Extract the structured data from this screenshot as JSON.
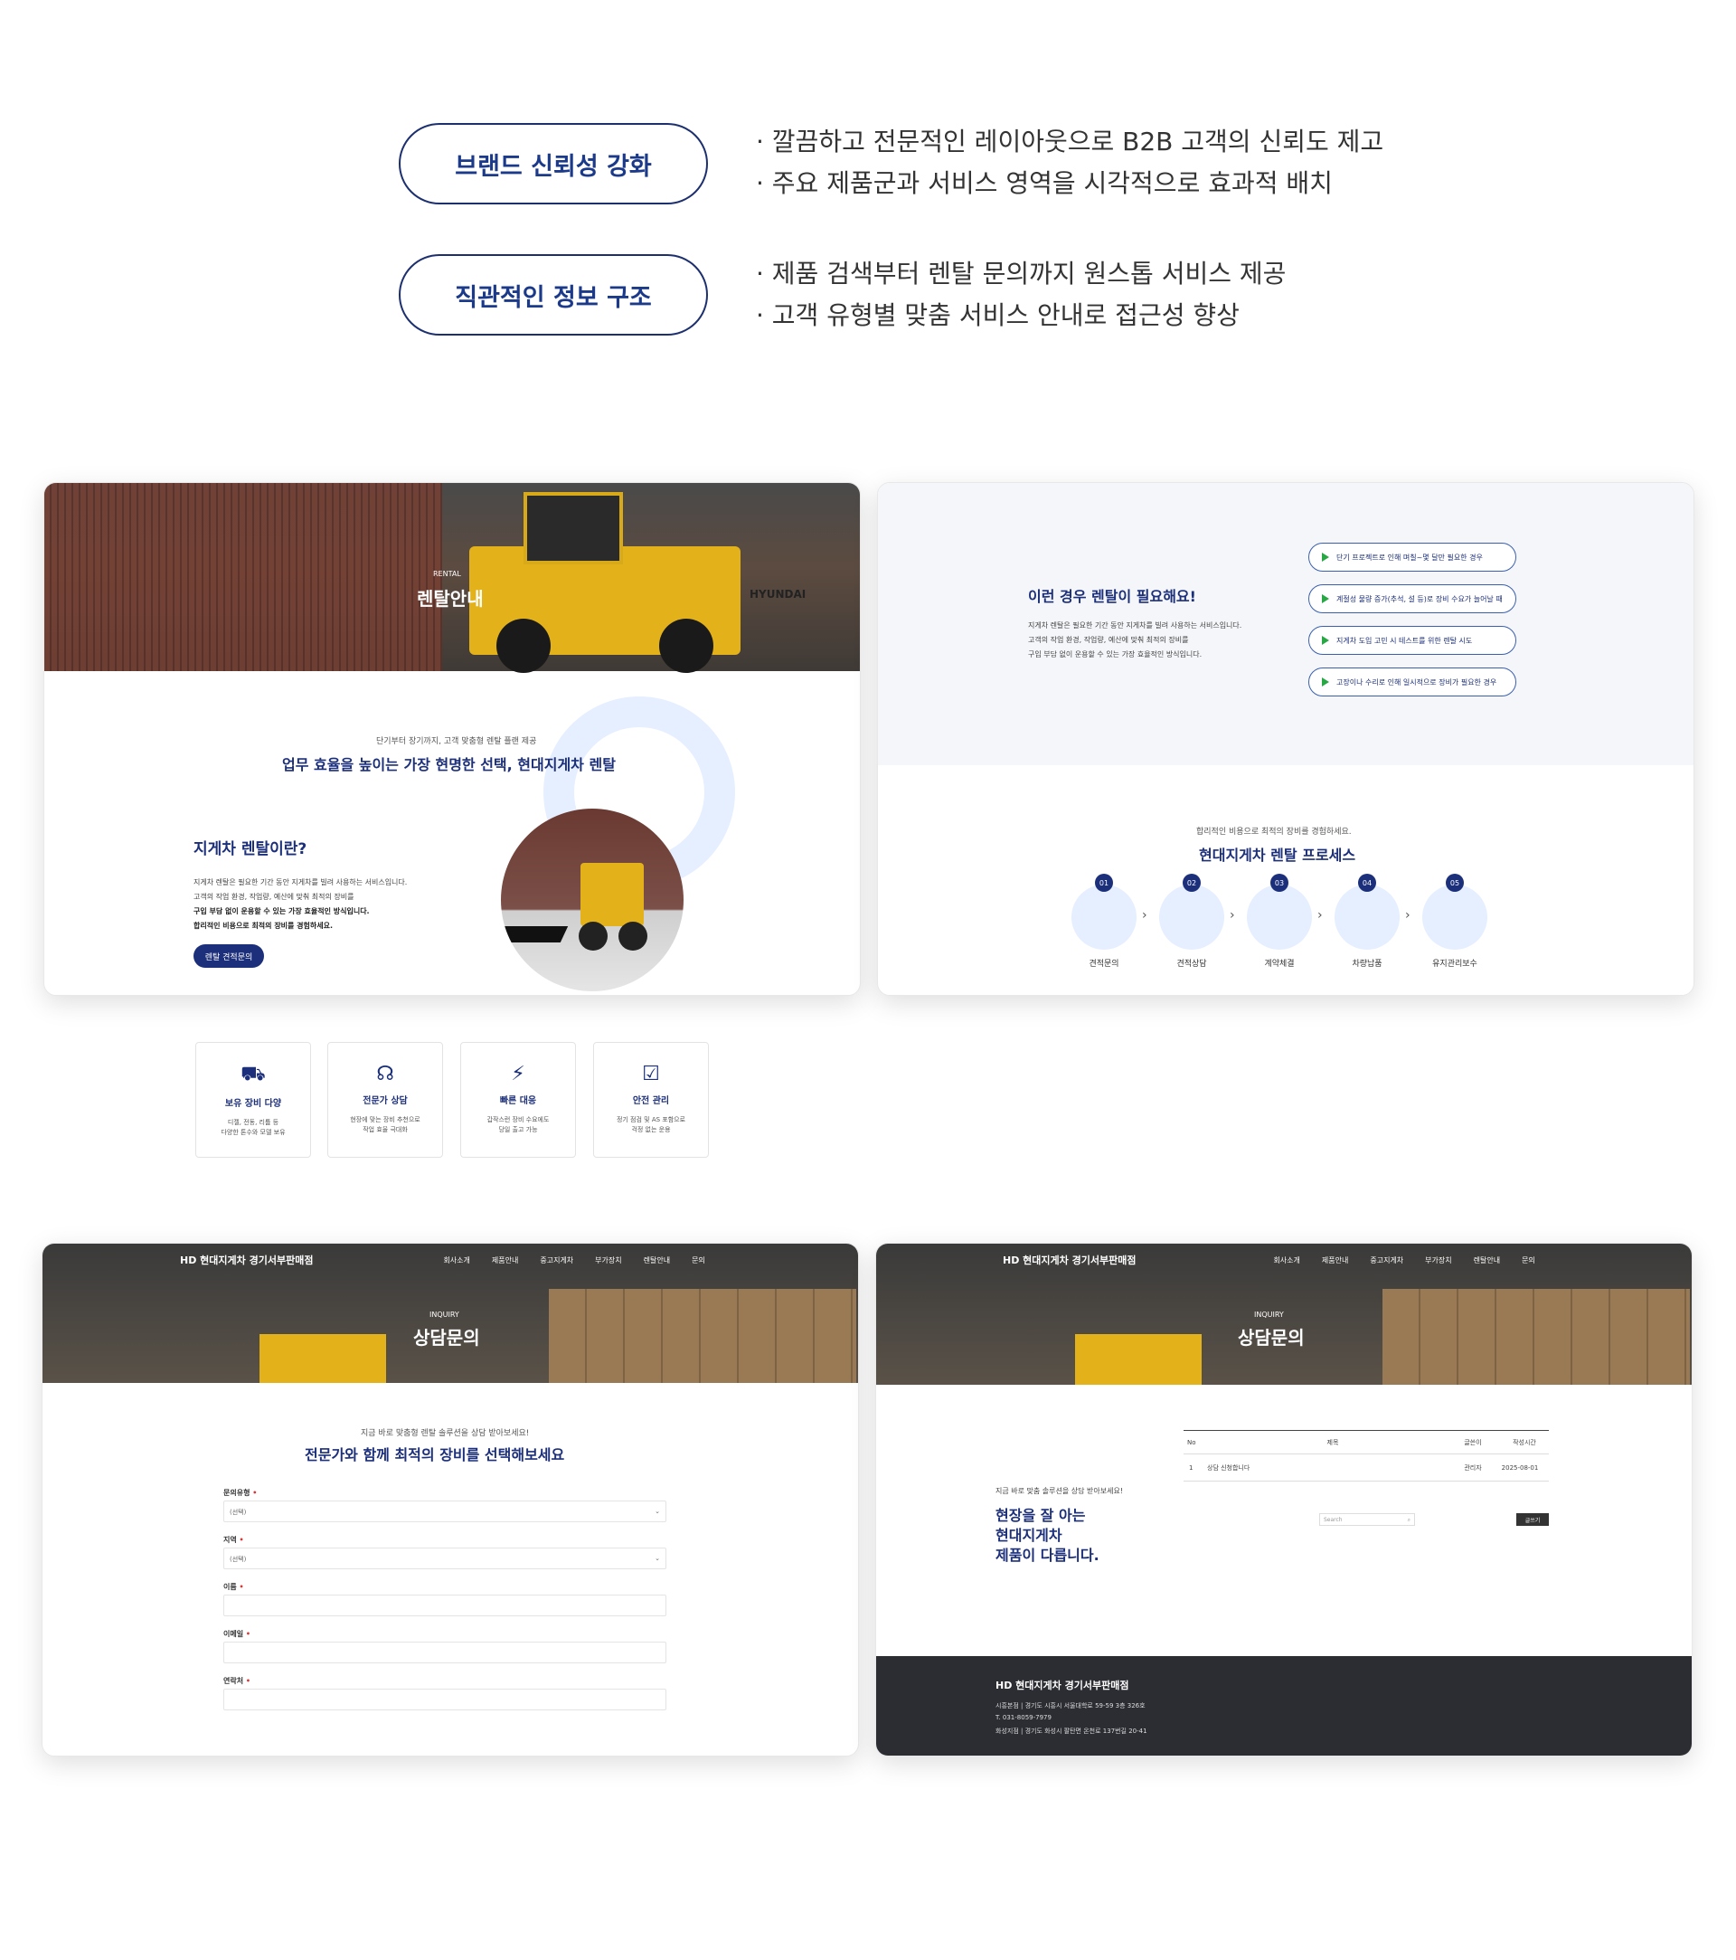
{
  "intro": {
    "items": [
      {
        "pill": "브랜드 신뢰성 강화",
        "bullets": [
          "· 깔끔하고 전문적인 레이아웃으로 B2B 고객의 신뢰도 제고",
          "· 주요 제품군과 서비스 영역을 시각적으로 효과적 배치"
        ]
      },
      {
        "pill": "직관적인 정보 구조",
        "bullets": [
          "· 제품 검색부터 렌탈 문의까지 원스톱 서비스 제공",
          "· 고객 유형별 맞춤 서비스 안내로 접근성 향상"
        ]
      }
    ]
  },
  "rental": {
    "hero_sub": "RENTAL",
    "hero_title": "렌탈안내",
    "brand_text": "HYUNDAI",
    "intro_sub": "단기부터 장기까지, 고객 맞춤형 렌탈 플랜 제공",
    "intro_title": "업무 효율을 높이는 가장 현명한 선택, 현대지게차 렌탈",
    "what_title": "지게차 렌탈이란?",
    "what_lines": [
      "지게차 렌탈은 필요한 기간 동안 지게차를 빌려 사용하는 서비스입니다.",
      "고객의 작업 환경, 작업량, 예산에 맞춰 최적의 장비를"
    ],
    "what_bold": [
      "구입 부담 없이 운용할 수 있는 가장 효율적인 방식입니다.",
      "합리적인 비용으로 최적의 장비를 경험하세요."
    ],
    "button": "렌탈 견적문의",
    "cards": [
      {
        "title": "보유 장비 다양",
        "desc": [
          "디젤, 전동, 리튬 등",
          "다양한 톤수와 모델 보유"
        ]
      },
      {
        "title": "전문가 상담",
        "desc": [
          "현장에 맞는 장비 추천으로",
          "작업 효율 극대화"
        ]
      },
      {
        "title": "빠른 대응",
        "desc": [
          "갑작스런 장비 수요에도",
          "당일 출고 가능"
        ]
      },
      {
        "title": "안전 관리",
        "desc": [
          "정기 점검 및 AS 포함으로",
          "걱정 없는 운용"
        ]
      }
    ]
  },
  "need": {
    "title": "이런 경우 렌탈이 필요해요!",
    "lines": [
      "지게차 렌탈은 필요한 기간 동안 지게차를 빌려 사용하는 서비스입니다.",
      "고객의 작업 환경, 작업량, 예산에 맞춰 최적의 장비를",
      "구입 부담 없이 운용할 수 있는 가장 효율적인 방식입니다."
    ],
    "cases": [
      "단기 프로젝트로 인해 며칠~몇 달만 필요한 경우",
      "계절성 물량 증가(추석, 설 등)로 장비 수요가 늘어날 때",
      "지게차 도입 고민 시 테스트를 위한 렌탈 시도",
      "고장이나 수리로 인해 일시적으로 장비가 필요한 경우"
    ],
    "process_sub": "합리적인 비용으로 최적의 장비를 경험하세요.",
    "process_title": "현대지게차 렌탈 프로세스",
    "steps": [
      {
        "num": "01",
        "label": "견적문의"
      },
      {
        "num": "02",
        "label": "견적상담"
      },
      {
        "num": "03",
        "label": "계약체결"
      },
      {
        "num": "04",
        "label": "차량납품"
      },
      {
        "num": "05",
        "label": "유지관리보수"
      }
    ]
  },
  "nav": {
    "logo": "HD 현대지게차 경기서부판매점",
    "menu": [
      "회사소개",
      "제품안내",
      "중고지게차",
      "부가장치",
      "렌탈안내",
      "문의"
    ]
  },
  "inquiry": {
    "hero_sub": "INQUIRY",
    "hero_title": "상담문의",
    "sub": "지금 바로 맞춤형 렌탈 솔루션을 상담 받아보세요!",
    "title": "전문가와 함께 최적의 장비를 선택해보세요",
    "fields": [
      {
        "label": "문의유형",
        "value": "(선택)"
      },
      {
        "label": "지역",
        "value": "(선택)"
      },
      {
        "label": "이름",
        "value": ""
      },
      {
        "label": "이메일",
        "value": ""
      },
      {
        "label": "연락처",
        "value": ""
      }
    ]
  },
  "board": {
    "side_sub": "지금 바로 맞춤 솔루션을 상담 받아보세요!",
    "side_title": [
      "현장을 잘 아는",
      "현대지게차",
      "제품이 다릅니다."
    ],
    "headers": [
      "No",
      "제목",
      "글쓴이",
      "작성시간"
    ],
    "row": {
      "no": "1",
      "title": "상담 신청합니다",
      "author": "관리자",
      "date": "2025-08-01"
    },
    "search_placeholder": "Search",
    "write_button": "글쓰기",
    "footer_logo": "HD 현대지게차 경기서부판매점",
    "footer_lines": [
      "시흥본점 | 경기도 시흥시 서울대학로 59-59 3층 326호",
      "T. 031-8059-7979",
      "화성지점 | 경기도 화성시 팔탄면 온천로 137번길 20-41"
    ]
  }
}
